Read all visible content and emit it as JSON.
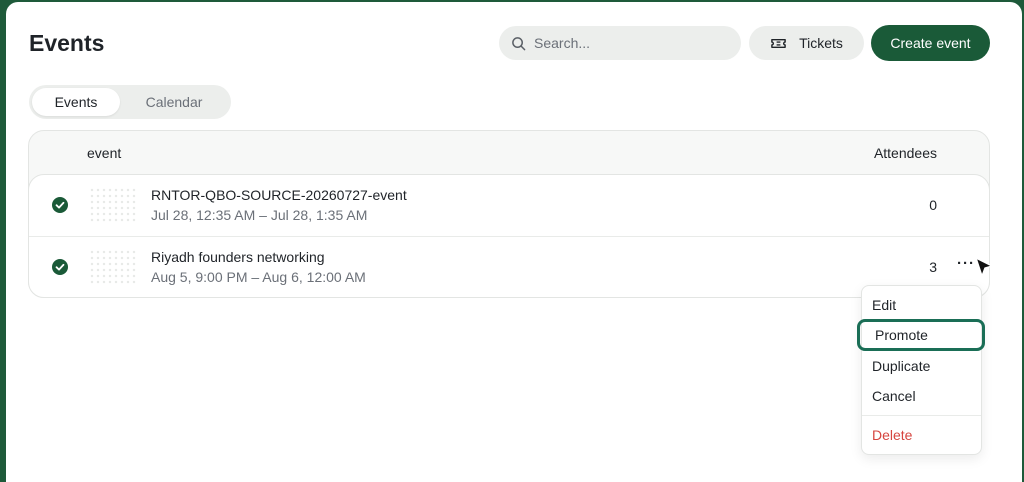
{
  "header": {
    "title": "Events",
    "search_placeholder": "Search...",
    "tickets_label": "Tickets",
    "create_label": "Create event"
  },
  "tabs": [
    {
      "label": "Events",
      "active": true
    },
    {
      "label": "Calendar",
      "active": false
    }
  ],
  "table": {
    "columns": {
      "event": "event",
      "attendees": "Attendees"
    },
    "rows": [
      {
        "name": "RNTOR-QBO-SOURCE-20260727-event",
        "date": "Jul 28, 12:35 AM – Jul 28, 1:35 AM",
        "attendees": "0",
        "status": "check-circle-icon"
      },
      {
        "name": "Riyadh founders networking",
        "date": "Aug 5, 9:00 PM – Aug 6, 12:00 AM",
        "attendees": "3",
        "status": "check-circle-icon"
      }
    ],
    "more_label": "···"
  },
  "context_menu": {
    "items": [
      {
        "label": "Edit"
      },
      {
        "label": "Promote",
        "highlighted": true
      },
      {
        "label": "Duplicate"
      },
      {
        "label": "Cancel"
      },
      {
        "label": "Delete",
        "danger": true
      }
    ]
  },
  "colors": {
    "brand": "#1a5a38",
    "highlight_border": "#1a6e56",
    "danger": "#d6453f",
    "muted_text": "#6b7078"
  }
}
